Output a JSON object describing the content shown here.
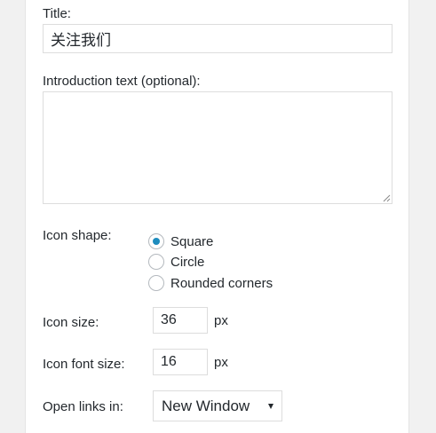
{
  "form": {
    "title_label": "Title:",
    "title_value": "关注我们",
    "intro_label": "Introduction text (optional):",
    "intro_value": "",
    "icon_shape_label": "Icon shape:",
    "icon_shape_options": [
      {
        "label": "Square",
        "checked": true
      },
      {
        "label": "Circle",
        "checked": false
      },
      {
        "label": "Rounded corners",
        "checked": false
      }
    ],
    "icon_size_label": "Icon size:",
    "icon_size_value": "36",
    "icon_size_unit": "px",
    "icon_font_size_label": "Icon font size:",
    "icon_font_size_value": "16",
    "icon_font_size_unit": "px",
    "open_links_label": "Open links in:",
    "open_links_value": "New Window"
  },
  "colors": {
    "page_background": "#f1f1f1",
    "panel_background": "#ffffff",
    "input_border": "#dddddd",
    "radio_selected": "#1e8cbe",
    "text": "#23282d"
  },
  "icons": {
    "resize_grip": "resize-grip-icon",
    "select_arrow": "caret-down-icon"
  }
}
